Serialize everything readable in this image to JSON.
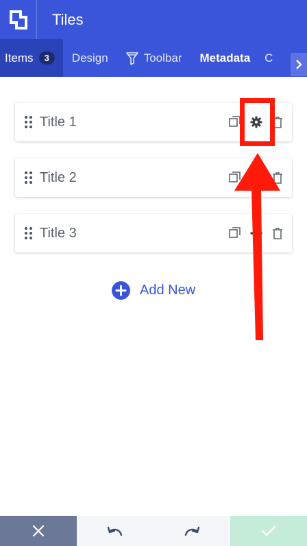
{
  "header": {
    "title": "Tiles",
    "logo_icon": "tiles-logo-icon"
  },
  "tabs": [
    {
      "label": "Items",
      "badge": "3",
      "active": true
    },
    {
      "label": "Design"
    },
    {
      "label": "Toolbar",
      "icon": "filter-funnel-icon"
    },
    {
      "label": "Metadata"
    },
    {
      "label": "C"
    }
  ],
  "items": [
    {
      "title": "Title 1"
    },
    {
      "title": "Title 2"
    },
    {
      "title": "Title 3"
    }
  ],
  "add_new": {
    "label": "Add New"
  },
  "colors": {
    "brand": "#3a55d9",
    "annotation": "#ff1a0a",
    "cancel_bg": "#6b7897",
    "save_bg": "#c5ecd9"
  },
  "bottom_bar": {
    "cancel_icon": "close-icon",
    "undo_icon": "undo-icon",
    "redo_icon": "redo-icon",
    "save_icon": "check-icon"
  }
}
